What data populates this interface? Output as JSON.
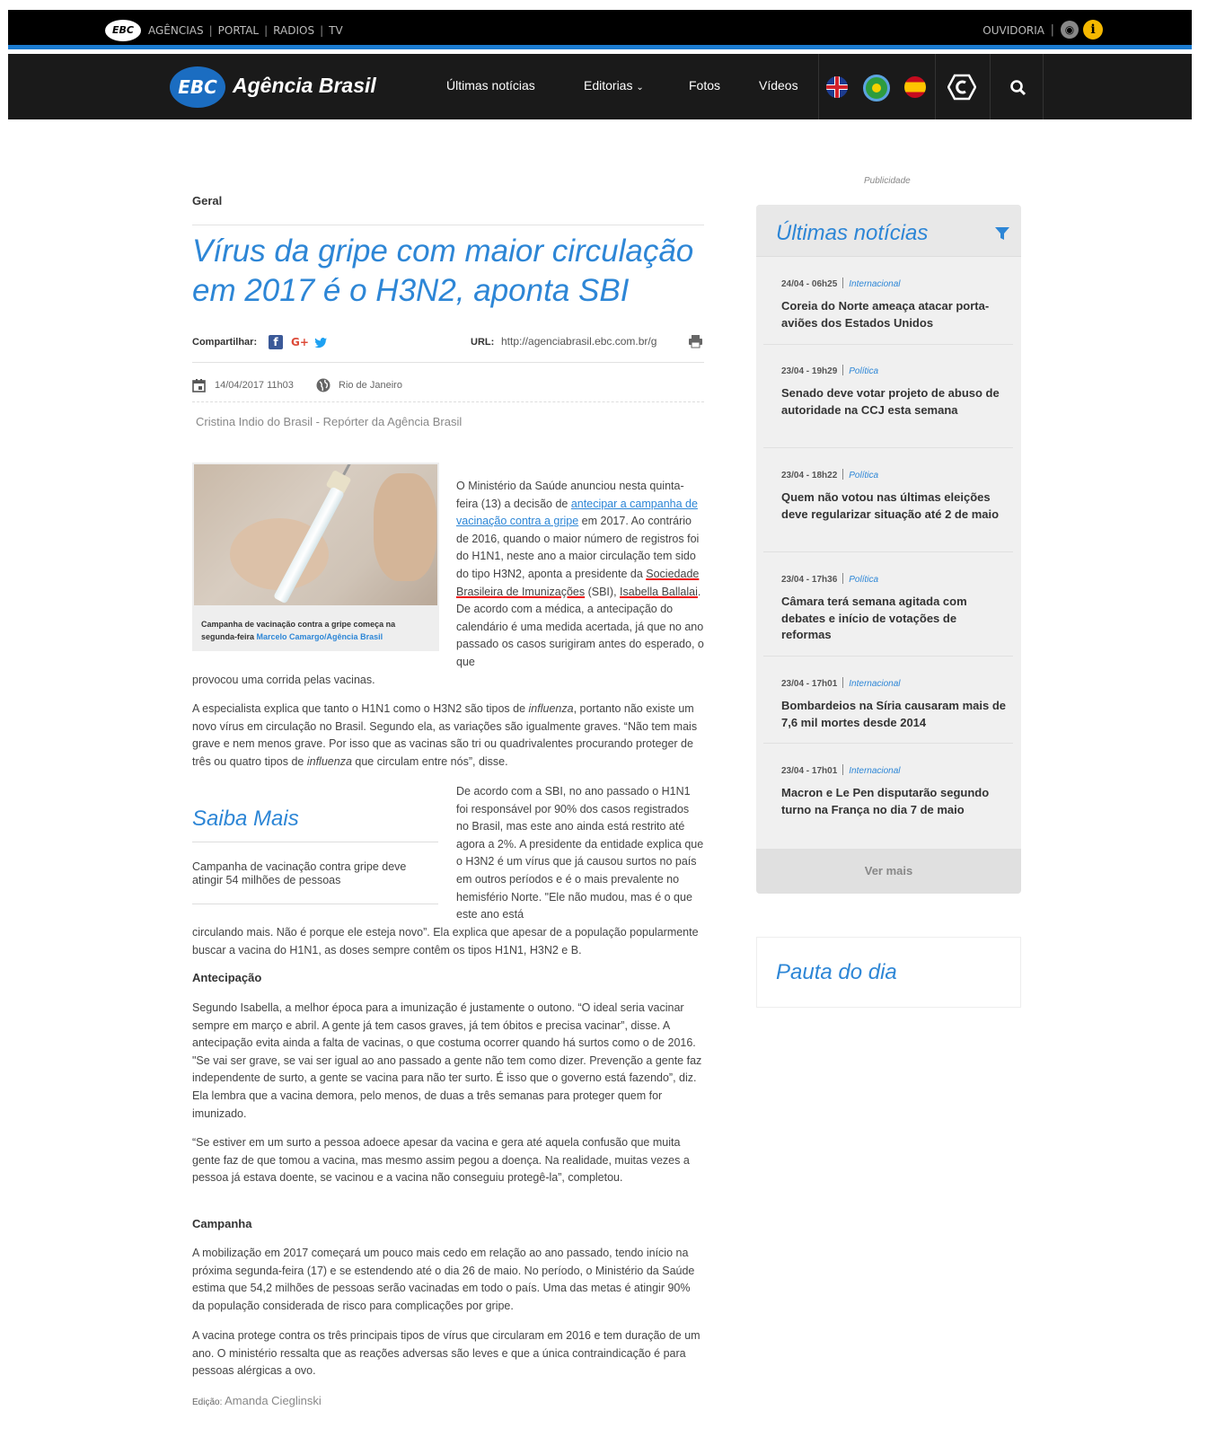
{
  "topbar": {
    "logo": "EBC",
    "links": [
      "AGÊNCIAS",
      "PORTAL",
      "RADIOS",
      "TV"
    ],
    "ouvidoria": "OUVIDORIA",
    "rss_icon": "rss-icon",
    "info_icon": "info-icon"
  },
  "nav": {
    "logo_badge": "EBC",
    "logo_text": "Agência Brasil",
    "menu": [
      "Últimas notícias",
      "Editorias",
      "Fotos",
      "Vídeos"
    ],
    "flags": [
      "uk-flag-icon",
      "brazil-flag-icon",
      "spain-flag-icon"
    ]
  },
  "article": {
    "category": "Geral",
    "title": "Vírus da gripe com maior circulação em 2017 é o H3N2, aponta SBI",
    "share_label": "Compartilhar:",
    "share_icons": {
      "fb": "f",
      "gplus": "G+",
      "twitter": "twitter-icon"
    },
    "url_label": "URL:",
    "url_value": "http://agenciabrasil.ebc.com.br/g",
    "date": "14/04/2017 11h03",
    "location": "Rio de Janeiro",
    "author": "Cristina Indio do Brasil - Repórter da Agência Brasil",
    "photo_caption": "Campanha de vacinação contra a gripe começa na segunda-feira",
    "photo_credit": "Marcelo Camargo/Agência Brasil",
    "p1_a": "O Ministério da Saúde anunciou nesta quinta-feira (13) a decisão de ",
    "p1_link": "antecipar a campanha de vacinação contra a gripe",
    "p1_b": " em 2017. Ao contrário de 2016, quando o maior número de registros foi do H1N1, neste ano a maior circulação tem sido do tipo H3N2, aponta a presidente da ",
    "p1_sbi": "Sociedade Brasileira de Imunizações",
    "p1_c": " (SBI), ",
    "p1_name": "Isabella Ballalai",
    "p1_d": ". De acordo com a médica, a antecipação do calendário é uma medida acertada, já que no ano passado os casos surigiram antes do esperado, o que",
    "p1_e": "provocou uma corrida pelas vacinas.",
    "p2_a": "A especialista explica que tanto o H1N1 como o H3N2 são tipos de ",
    "p2_influenza1": "influenza",
    "p2_b": ", portanto não existe um novo vírus em circulação no Brasil. Segundo ela, as variações são igualmente graves. “Não tem mais grave e nem menos grave. Por isso que as vacinas são tri ou quadrivalentes procurando proteger de três ou quatro tipos de ",
    "p2_influenza2": "influenza",
    "p2_c": " que circulam entre nós”, disse.",
    "saiba_title": "Saiba Mais",
    "saiba_link": "Campanha de vacinação contra gripe deve atingir 54 milhões de pessoas",
    "p3_a": "De acordo com a SBI,  no ano passado o H1N1 foi responsável por 90% dos casos registrados no Brasil, mas este ano ainda está restrito até agora a 2%. A presidente da entidade explica que o H3N2 é um vírus que já causou surtos no país em outros períodos e é o mais prevalente no hemisfério Norte. \"Ele não mudou, mas é o que este ano está",
    "p3_b": "circulando mais. Não é porque ele esteja novo”.  Ela explica que apesar de a população popularmente buscar a vacina do H1N1, as doses sempre contêm os tipos H1N1, H3N2 e B.",
    "h_antecipacao": "Antecipação",
    "p4": "Segundo Isabella, a melhor época para a imunização é justamente o outono. “O ideal seria vacinar sempre em março e abril. A gente já tem casos graves, já tem óbitos e  precisa vacinar”, disse. A antecipação evita ainda a falta de vacinas, o que costuma ocorrer quando há surtos como o de 2016. \"Se vai ser grave, se vai ser igual ao ano passado a gente não tem como dizer. Prevenção a gente faz independente de surto, a gente se vacina para não ter surto. É isso que o governo está fazendo”, diz. Ela lembra que a vacina demora, pelo menos, de duas a três semanas para proteger quem for imunizado.",
    "p5": "“Se estiver em um surto a pessoa adoece apesar da vacina e gera até aquela confusão que muita gente faz de que tomou a vacina, mas mesmo assim pegou a doença. Na realidade, muitas vezes a pessoa já estava doente, se vacinou e a vacina não conseguiu protegê-la”, completou.",
    "h_campanha": "Campanha",
    "p6": "A mobilização em 2017 começará um pouco mais cedo em relação ao ano passado, tendo início na próxima segunda-feira (17) e se estendendo até o dia 26 de maio. No período, o Ministério da Saúde estima que 54,2 milhões de pessoas serão vacinadas em todo o país. Uma das metas é atingir 90% da população considerada de risco para complicações por gripe.",
    "p7": "A vacina protege contra os três principais tipos de vírus que circularam em 2016 e tem duração de um ano. O ministério ressalta que as reações adversas são leves e que a única contraindicação é para pessoas alérgicas a ovo.",
    "edit_label": "Edição:",
    "edit_name": "Amanda Cieglinski"
  },
  "sidebar": {
    "publicidade": "Publicidade",
    "ultimas_title": "Últimas notícias",
    "news": [
      {
        "date": "24/04 - 06h25",
        "category": "Internacional",
        "title": "Coreia do Norte ameaça atacar porta-aviões dos Estados Unidos"
      },
      {
        "date": "23/04 - 19h29",
        "category": "Política",
        "title": "Senado deve votar projeto de abuso de autoridade na CCJ esta semana"
      },
      {
        "date": "23/04 - 18h22",
        "category": "Política",
        "title": "Quem não votou nas últimas eleições deve regularizar situação até 2 de maio"
      },
      {
        "date": "23/04 - 17h36",
        "category": "Política",
        "title": "Câmara terá semana agitada com debates e início de votações de reformas"
      },
      {
        "date": "23/04 - 17h01",
        "category": "Internacional",
        "title": "Bombardeios na Síria causaram mais de 7,6 mil mortes desde 2014"
      },
      {
        "date": "23/04 - 17h01",
        "category": "Internacional",
        "title": "Macron e Le Pen disputarão segundo turno na França no dia 7 de maio"
      }
    ],
    "ver_mais": "Ver mais",
    "pauta_title": "Pauta do dia"
  }
}
